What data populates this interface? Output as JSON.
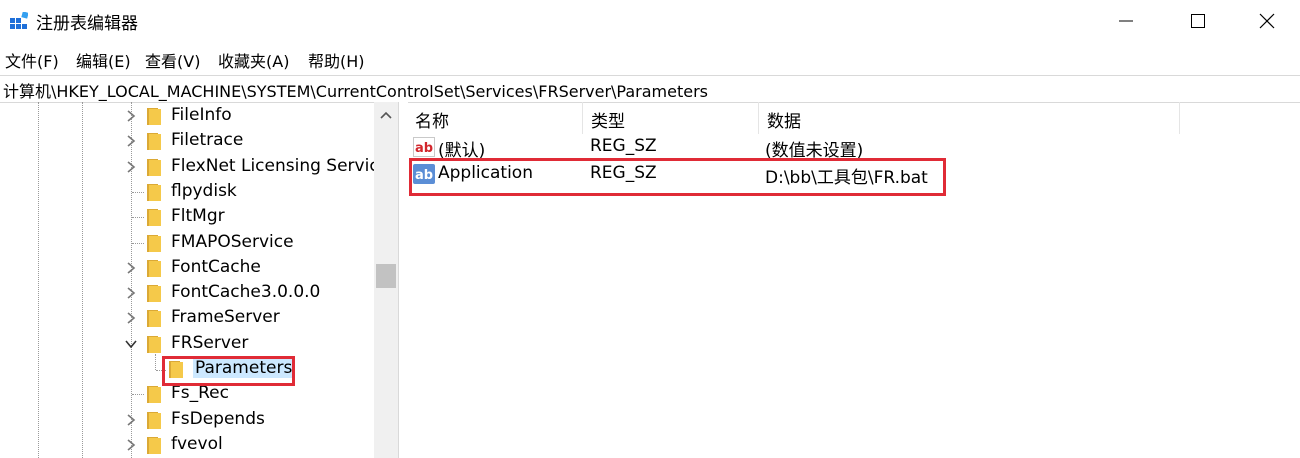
{
  "window": {
    "title": "注册表编辑器"
  },
  "menu": [
    "文件(F)",
    "编辑(E)",
    "查看(V)",
    "收藏夹(A)",
    "帮助(H)"
  ],
  "address": "计算机\\HKEY_LOCAL_MACHINE\\SYSTEM\\CurrentControlSet\\Services\\FRServer\\Parameters",
  "tree": {
    "items": [
      {
        "label": "FileInfo",
        "expander": "collapsed"
      },
      {
        "label": "Filetrace",
        "expander": "collapsed"
      },
      {
        "label": "FlexNet Licensing Servic",
        "expander": "collapsed"
      },
      {
        "label": "flpydisk",
        "expander": "none"
      },
      {
        "label": "FltMgr",
        "expander": "none"
      },
      {
        "label": "FMAPOService",
        "expander": "none"
      },
      {
        "label": "FontCache",
        "expander": "collapsed"
      },
      {
        "label": "FontCache3.0.0.0",
        "expander": "collapsed"
      },
      {
        "label": "FrameServer",
        "expander": "collapsed"
      },
      {
        "label": "FRServer",
        "expander": "expanded"
      },
      {
        "label": "Parameters",
        "expander": "none",
        "child": true,
        "selected": true
      },
      {
        "label": "Fs_Rec",
        "expander": "none"
      },
      {
        "label": "FsDepends",
        "expander": "collapsed"
      },
      {
        "label": "fvevol",
        "expander": "collapsed"
      }
    ]
  },
  "values": {
    "headers": {
      "name": "名称",
      "type": "类型",
      "data": "数据"
    },
    "rows": [
      {
        "name": "(默认)",
        "type": "REG_SZ",
        "data": "(数值未设置)",
        "icon": "ab-string-icon"
      },
      {
        "name": "Application",
        "type": "REG_SZ",
        "data": "D:\\bb\\工具包\\FR.bat",
        "icon": "ab-string-icon",
        "selected": true
      }
    ]
  },
  "colors": {
    "highlight": "#e02b36",
    "folder": "#f5c94a",
    "selection": "#cce8ff"
  }
}
